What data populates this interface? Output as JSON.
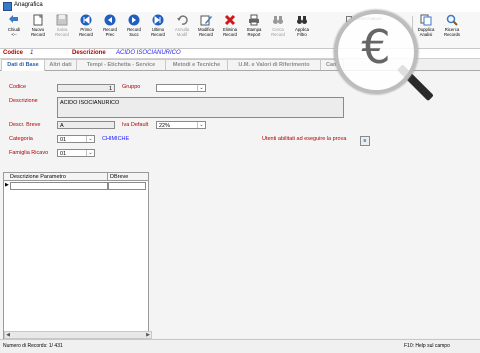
{
  "window": {
    "title": "Anagrafica"
  },
  "toolbar": {
    "buttons": [
      {
        "label": "Chiudi\n<--",
        "icon": "close-arrow-icon"
      },
      {
        "label": "Nuovo\nRecord",
        "icon": "new-record-icon"
      },
      {
        "label": "Salva\nRecord",
        "icon": "save-icon"
      },
      {
        "label": "Primo\nRecord",
        "icon": "first-record-icon"
      },
      {
        "label": "Record\nPrec",
        "icon": "prev-record-icon"
      },
      {
        "label": "Record\nSucc",
        "icon": "next-record-icon"
      },
      {
        "label": "Ultimo\nRecord",
        "icon": "last-record-icon"
      },
      {
        "label": "Annulla\nModif",
        "icon": "undo-icon"
      },
      {
        "label": "Modifica\nRecord",
        "icon": "edit-icon"
      },
      {
        "label": "Elimina\nRecord",
        "icon": "delete-icon"
      },
      {
        "label": "Stampa\nReport",
        "icon": "print-icon"
      },
      {
        "label": "Cerca\nRecord",
        "icon": "search-binoculars-icon"
      },
      {
        "label": "Applica\nFiltro",
        "icon": "filter-icon"
      },
      {
        "label": "Dupplica\nAnalisi",
        "icon": "duplicate-icon"
      },
      {
        "label": "Ricerca\nRecords",
        "icon": "search-magnifier-icon"
      }
    ],
    "small_check_label": "Annerchiature"
  },
  "header": {
    "codice_label": "Codice",
    "codice_value": "1",
    "descrizione_label": "Descrizione",
    "descrizione_value": "ACIDO ISOCIANURICO"
  },
  "tabs": [
    "Dati di Base",
    "Altri dati",
    "Tempi - Etichetta - Service",
    "Metodi e Tecniche",
    "U.M. e Valori di Riferimento",
    "Cam"
  ],
  "form": {
    "codice_label": "Codice",
    "codice_value": "1",
    "gruppo_label": "Gruppo",
    "gruppo_value": "",
    "descrizione_label": "Descrizione",
    "descrizione_value": "ACIDO ISOCIANURICO",
    "descr_breve_label": "Descr. Breve",
    "descr_breve_value": "A",
    "iva_label": "Iva Default",
    "iva_value": "22%",
    "categoria_label": "Categoria",
    "categoria_value": "01",
    "categoria_desc": "CHIMICHE",
    "famiglia_label": "Famiglia Ricavo",
    "famiglia_value": "01",
    "utenti_label": "Utenti abilitati ad eseguire la prova"
  },
  "grid": {
    "columns": [
      "Descrizione Parametro",
      "DBreve"
    ]
  },
  "status": {
    "record_count": "Numero di Records: 1/ 431",
    "help_text": "F10: Help sul campo"
  }
}
